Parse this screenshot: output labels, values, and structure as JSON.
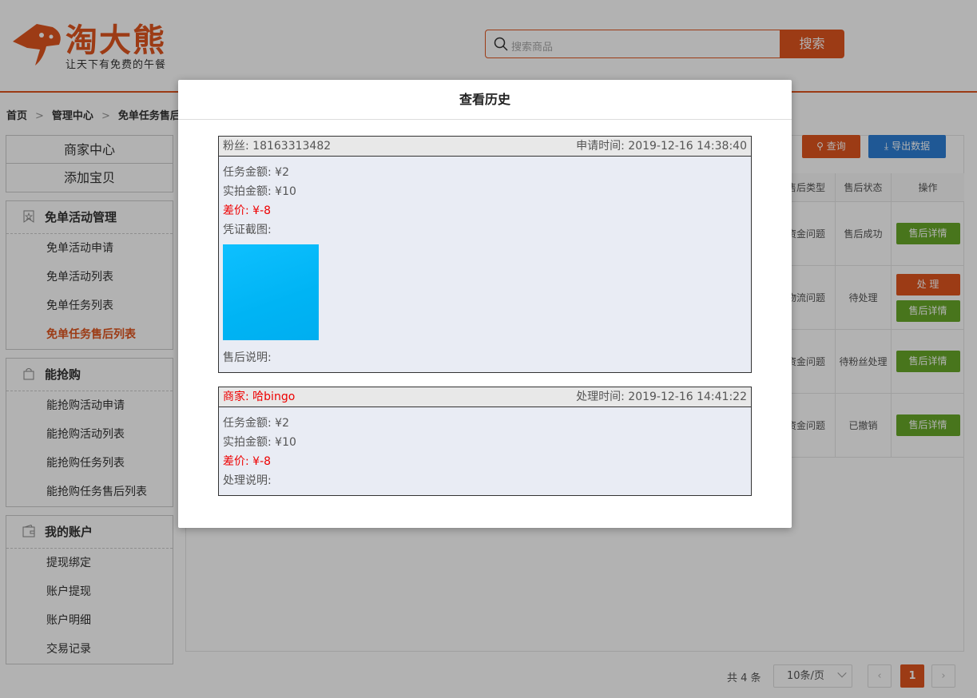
{
  "header": {
    "brand": "淘大熊",
    "slogan": "让天下有免费的午餐",
    "search_placeholder": "搜索商品",
    "search_button": "搜索"
  },
  "breadcrumb": [
    "首页",
    "管理中心",
    "免单任务售后列表"
  ],
  "sidebar": {
    "top_items": [
      "商家中心",
      "添加宝贝"
    ],
    "groups": [
      {
        "title": "免单活动管理",
        "icon": "star-badge-icon",
        "items": [
          "免单活动申请",
          "免单活动列表",
          "免单任务列表",
          "免单任务售后列表"
        ],
        "active_index": 3
      },
      {
        "title": "能抢购",
        "icon": "shopping-bag-icon",
        "items": [
          "能抢购活动申请",
          "能抢购活动列表",
          "能抢购任务列表",
          "能抢购任务售后列表"
        ]
      },
      {
        "title": "我的账户",
        "icon": "wallet-icon",
        "items": [
          "提现绑定",
          "账户提现",
          "账户明细",
          "交易记录"
        ]
      }
    ]
  },
  "toolbar": {
    "query": "查询",
    "export": "导出数据"
  },
  "table": {
    "headers": [
      "售后类型",
      "售后状态",
      "操作"
    ],
    "rows": [
      {
        "type": "资金问题",
        "status": "售后成功",
        "actions": [
          "售后详情"
        ]
      },
      {
        "type": "物流问题",
        "status": "待处理",
        "actions": [
          "处 理",
          "售后详情"
        ]
      },
      {
        "type": "资金问题",
        "status": "待粉丝处理",
        "actions": [
          "售后详情"
        ]
      },
      {
        "type": "资金问题",
        "status": "已撤销",
        "actions": [
          "售后详情"
        ]
      }
    ]
  },
  "pager": {
    "total": "共 4 条",
    "page_size": "10条/页",
    "current": "1",
    "prev": "‹",
    "next": "›"
  },
  "modal": {
    "title": "查看历史",
    "fan_record": {
      "fan": "粉丝: 18163313482",
      "apply_time": "申请时间: 2019-12-16 14:38:40",
      "task_amount": "任务金额: ¥2",
      "actual_amount": "实拍金额: ¥10",
      "diff": "差价: ¥-8",
      "proof_label": "凭证截图:",
      "note_label": "售后说明:"
    },
    "merchant_record": {
      "merchant": "商家: 哈bingo",
      "process_time": "处理时间: 2019-12-16 14:41:22",
      "task_amount": "任务金额: ¥2",
      "actual_amount": "实拍金额: ¥10",
      "diff": "差价: ¥-8",
      "note_label": "处理说明:"
    }
  },
  "colors": {
    "brand": "#e0551f",
    "export": "#2d7fd6",
    "success": "#67a829",
    "diff": "#ee0000"
  }
}
